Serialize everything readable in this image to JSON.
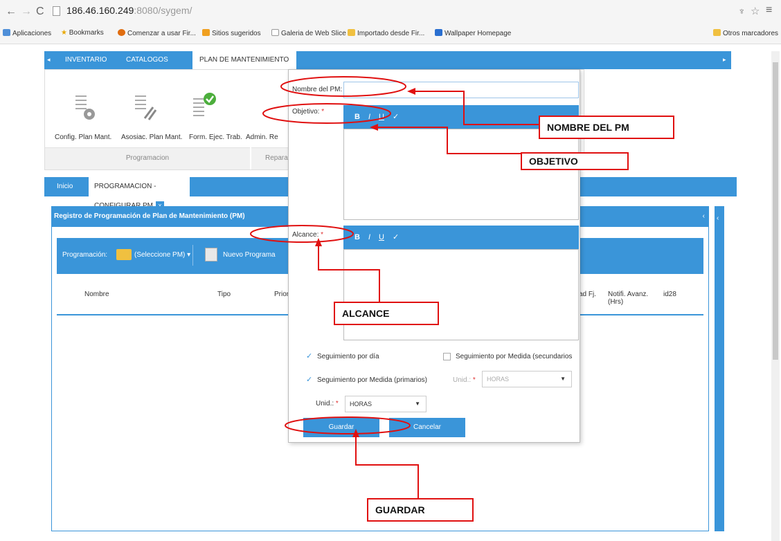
{
  "browser": {
    "url_host": "186.46.160.249",
    "url_path": ":8080/sygem/",
    "bookmarks": [
      "Aplicaciones",
      "Bookmarks",
      "Comenzar a usar Fir...",
      "Sitios sugeridos",
      "Galeria de Web Slice",
      "Importado desde Fir...",
      "Wallpaper Homepage"
    ],
    "other_bookmarks": "Otros marcadores"
  },
  "topnav": {
    "tabs": [
      "INVENTARIO",
      "CATALOGOS",
      "PLAN DE MANTENIMIENTO"
    ]
  },
  "ribbon": {
    "items": [
      "Config. Plan Mant.",
      "Asosiac. Plan Mant.",
      "Form. Ejec. Trab.",
      "Admin. Re"
    ],
    "groups": [
      "Programacion",
      "Repara"
    ]
  },
  "doctabs": {
    "home": "Inicio",
    "active": "PROGRAMACION - CONFIGURAR PM",
    "close": "x"
  },
  "panel": {
    "title": "Registro de Programación de Plan de Mantenimiento (PM)",
    "toolbar_label": "Programación:",
    "select_pm": "(Seleccione PM)",
    "new_program": "Nuevo Programa"
  },
  "grid": {
    "columns": [
      "Nombre",
      "Tipo",
      "Priori",
      "ad Fj.",
      "Notifi. Avanz. (Hrs)",
      "id28"
    ]
  },
  "dialog": {
    "name_label": "Nombre del PM:",
    "objetivo_label": "Objetivo:",
    "alcance_label": "Alcance:",
    "req_mark": "*",
    "editor_bold": "B",
    "editor_italic": "I",
    "editor_underline": "U",
    "editor_check": "✓",
    "follow_day": "Seguimiento por día",
    "follow_measure_secondary": "Seguimiento por Medida (secundarios",
    "follow_measure_primary": "Seguimiento por Medida (primarios)",
    "unit_label": "Unid.:",
    "unit_value": "HORAS",
    "save": "Guardar",
    "cancel": "Cancelar"
  },
  "annotations": {
    "nombre": "NOMBRE DEL PM",
    "objetivo": "OBJETIVO",
    "alcance": "ALCANCE",
    "guardar": "GUARDAR"
  },
  "colors": {
    "accent": "#3a95d9",
    "annotation": "#e01010"
  }
}
